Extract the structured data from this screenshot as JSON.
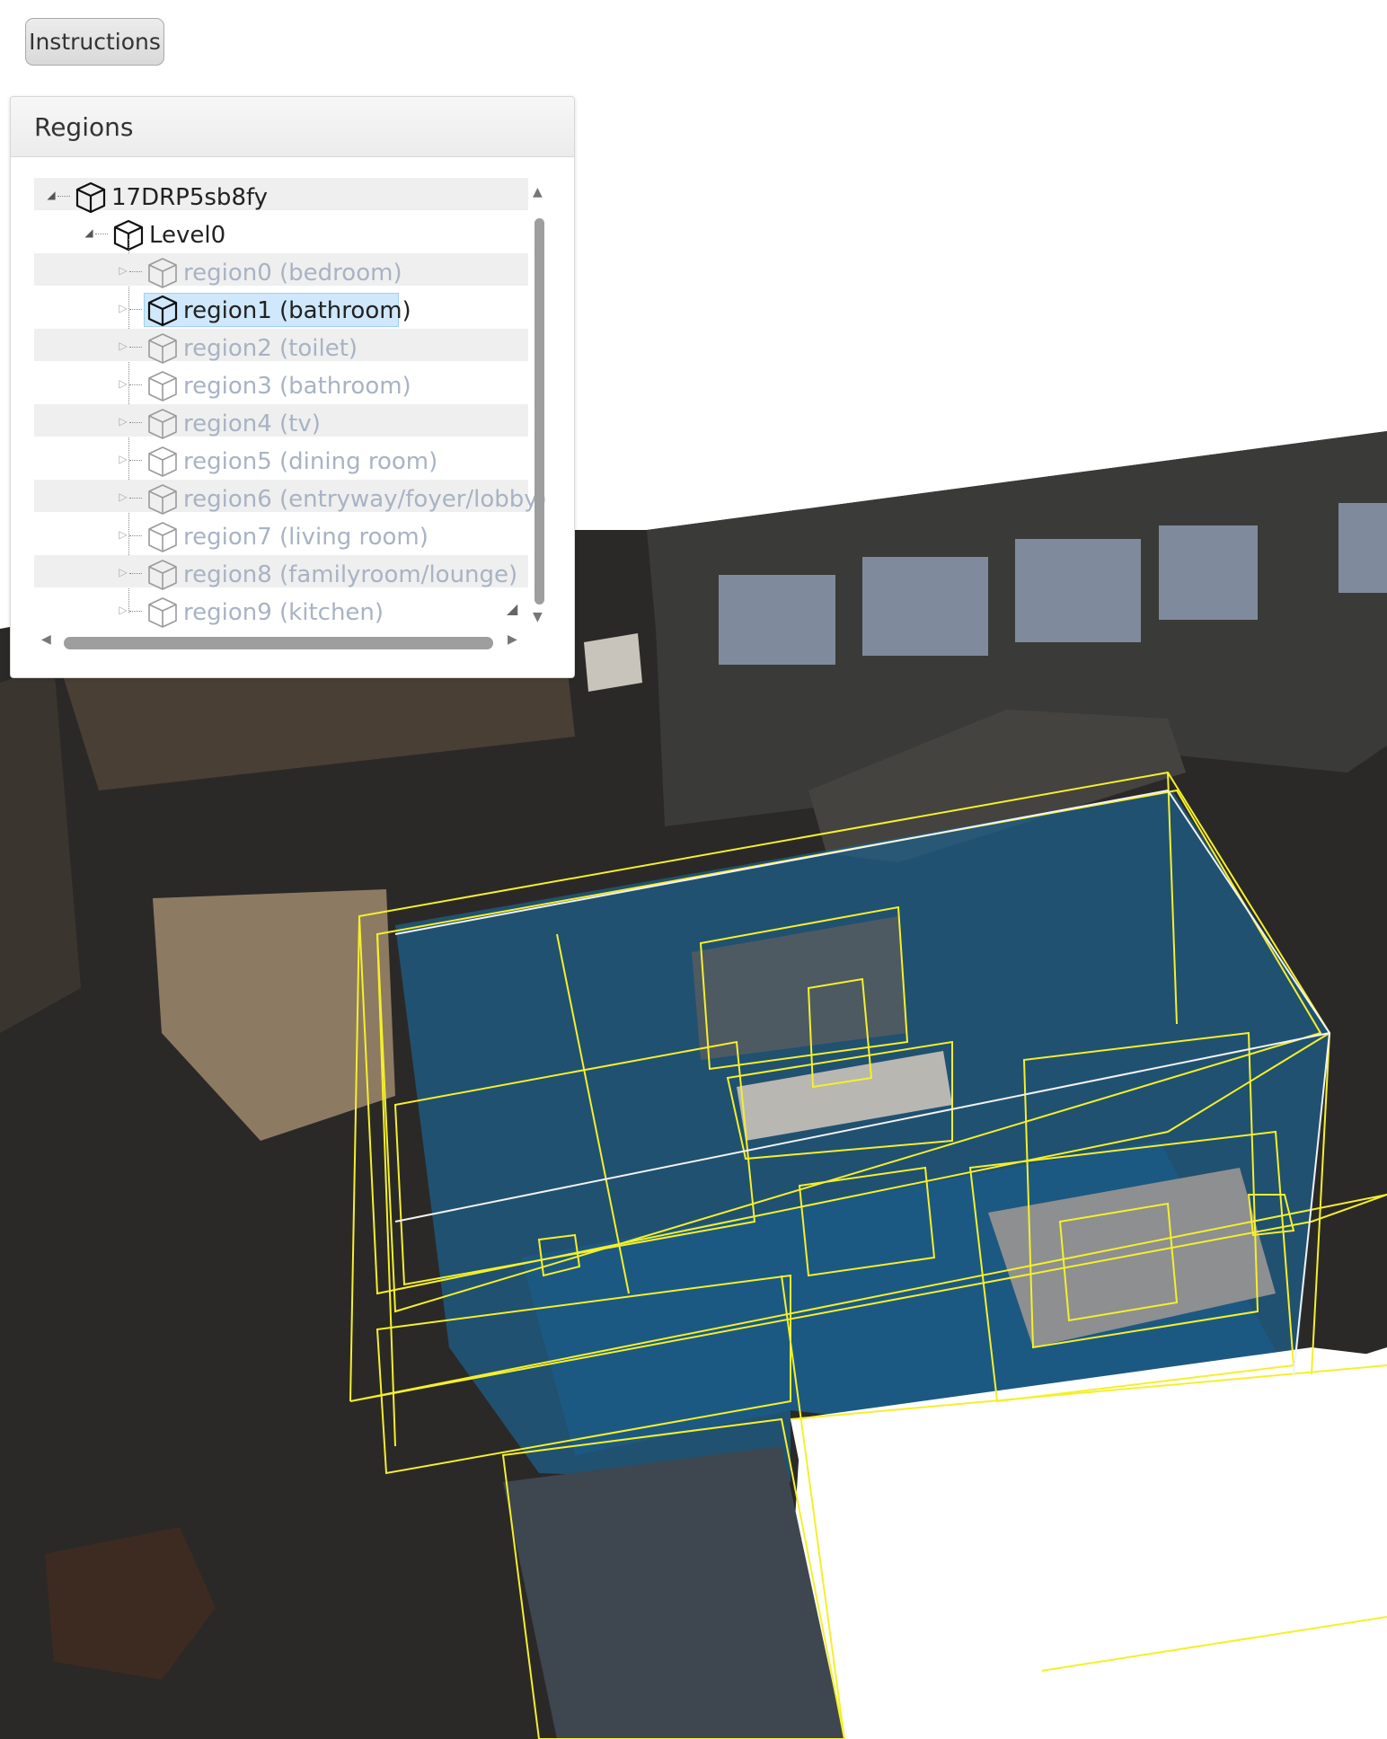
{
  "toolbar": {
    "instructions_label": "Instructions"
  },
  "panel": {
    "title": "Regions",
    "tree": {
      "root": {
        "label": "17DRP5sb8fy",
        "expanded": true,
        "icon": "cube-icon"
      },
      "level": {
        "label": "Level0",
        "expanded": true,
        "icon": "cube-icon"
      },
      "regions": [
        {
          "label": "region0 (bedroom)",
          "selected": false
        },
        {
          "label": "region1 (bathroom)",
          "selected": true
        },
        {
          "label": "region2 (toilet)",
          "selected": false
        },
        {
          "label": "region3 (bathroom)",
          "selected": false
        },
        {
          "label": "region4 (tv)",
          "selected": false
        },
        {
          "label": "region5 (dining room)",
          "selected": false
        },
        {
          "label": "region6 (entryway/foyer/lobby)",
          "selected": false
        },
        {
          "label": "region7 (living room)",
          "selected": false
        },
        {
          "label": "region8 (familyroom/lounge)",
          "selected": false
        },
        {
          "label": "region9 (kitchen)",
          "selected": false
        }
      ]
    }
  },
  "colors": {
    "selection": "#cfe8fb",
    "dim_text": "#a8b3c4",
    "bbox": "#f4f02a",
    "region_volume": "#1f5f8a",
    "scene_dark": "#2a2826"
  }
}
